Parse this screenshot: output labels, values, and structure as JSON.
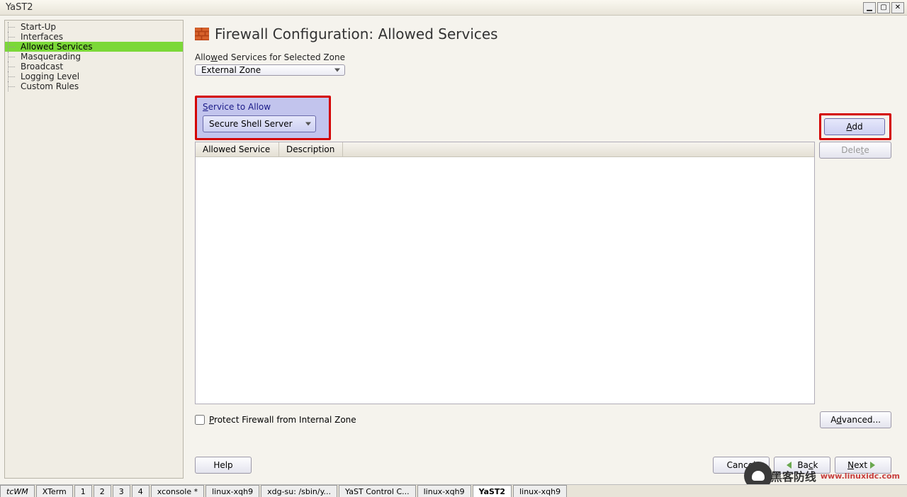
{
  "window": {
    "title": "YaST2"
  },
  "sidebar": {
    "items": [
      {
        "label": "Start-Up",
        "selected": false
      },
      {
        "label": "Interfaces",
        "selected": false
      },
      {
        "label": "Allowed Services",
        "selected": true
      },
      {
        "label": "Masquerading",
        "selected": false
      },
      {
        "label": "Broadcast",
        "selected": false
      },
      {
        "label": "Logging Level",
        "selected": false
      },
      {
        "label": "Custom Rules",
        "selected": false
      }
    ]
  },
  "page": {
    "title": "Firewall Configuration: Allowed Services",
    "zone_label_pre": "Allo",
    "zone_label_mn": "w",
    "zone_label_post": "ed Services for Selected Zone",
    "zone_value": "External Zone",
    "service_label_mn": "S",
    "service_label_post": "ervice to Allow",
    "service_value": "Secure Shell Server",
    "add_mn": "A",
    "add_post": "dd",
    "delete_pre": "Dele",
    "delete_mn": "t",
    "delete_post": "e",
    "col1": "Allowed Service",
    "col2": "Description",
    "protect_mn": "P",
    "protect_post": "rotect Firewall from Internal Zone",
    "advanced_pre": "A",
    "advanced_mn": "d",
    "advanced_post": "vanced...",
    "help": "Help",
    "cancel": "Cancel",
    "back_pre": "Ba",
    "back_mn": "c",
    "back_post": "k",
    "next_mn": "N",
    "next_post": "ext"
  },
  "taskbar": {
    "items": [
      "",
      "XTerm",
      "1",
      "2",
      "3",
      "4",
      "xconsole *",
      "linux-xqh9",
      "xdg-su: /sbin/y...",
      "YaST Control C...",
      "linux-xqh9",
      "YaST2",
      "linux-xqh9"
    ],
    "active_index": 11
  },
  "watermark": "www.linuxidc.com"
}
